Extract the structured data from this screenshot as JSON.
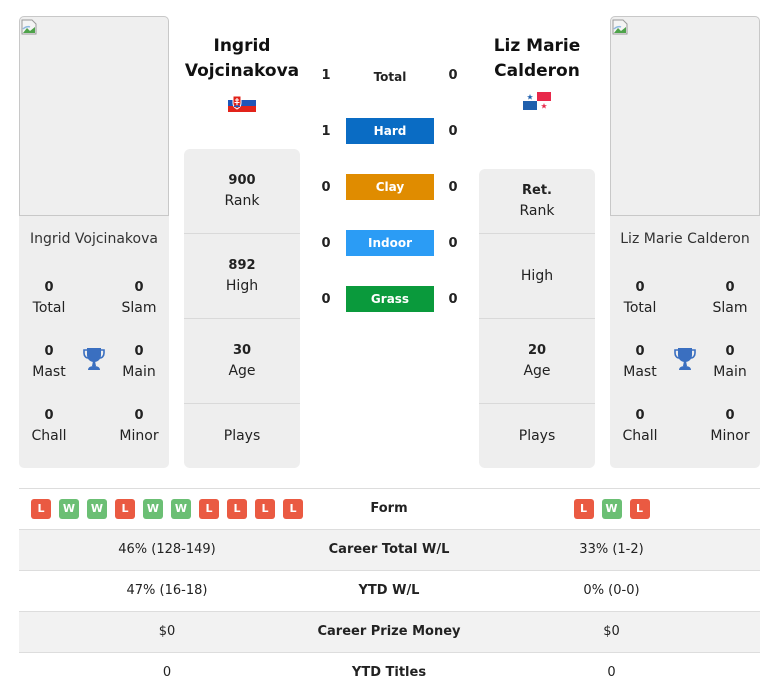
{
  "colors": {
    "hard": "#0a6cc4",
    "clay": "#e08c00",
    "indoor": "#2b9cf5",
    "grass": "#0a9a3c",
    "win": "#6bbf74",
    "loss": "#ea5a42",
    "trophy": "#3a6fc0"
  },
  "left_player": {
    "name": "Ingrid Vojcinakova",
    "name_line1": "Ingrid",
    "name_line2": "Vojcinakova",
    "flag_icon": "slovakia-flag-icon",
    "titles": {
      "total": {
        "value": "0",
        "label": "Total"
      },
      "slam": {
        "value": "0",
        "label": "Slam"
      },
      "mast": {
        "value": "0",
        "label": "Mast"
      },
      "main": {
        "value": "0",
        "label": "Main"
      },
      "chall": {
        "value": "0",
        "label": "Chall"
      },
      "minor": {
        "value": "0",
        "label": "Minor"
      }
    },
    "stats": [
      {
        "value": "900",
        "label": "Rank"
      },
      {
        "value": "892",
        "label": "High"
      },
      {
        "value": "30",
        "label": "Age"
      },
      {
        "value": "",
        "label": "Plays"
      }
    ]
  },
  "right_player": {
    "name": "Liz Marie Calderon",
    "name_line1": "Liz Marie",
    "name_line2": "Calderon",
    "flag_icon": "panama-flag-icon",
    "titles": {
      "total": {
        "value": "0",
        "label": "Total"
      },
      "slam": {
        "value": "0",
        "label": "Slam"
      },
      "mast": {
        "value": "0",
        "label": "Mast"
      },
      "main": {
        "value": "0",
        "label": "Main"
      },
      "chall": {
        "value": "0",
        "label": "Chall"
      },
      "minor": {
        "value": "0",
        "label": "Minor"
      }
    },
    "stats": [
      {
        "value": "Ret.",
        "label": "Rank"
      },
      {
        "value": "",
        "label": "High"
      },
      {
        "value": "20",
        "label": "Age"
      },
      {
        "value": "",
        "label": "Plays"
      }
    ]
  },
  "h2h": [
    {
      "label": "Total",
      "left": "1",
      "right": "0",
      "color_key": "none"
    },
    {
      "label": "Hard",
      "left": "1",
      "right": "0",
      "color_key": "hard"
    },
    {
      "label": "Clay",
      "left": "0",
      "right": "0",
      "color_key": "clay"
    },
    {
      "label": "Indoor",
      "left": "0",
      "right": "0",
      "color_key": "indoor"
    },
    {
      "label": "Grass",
      "left": "0",
      "right": "0",
      "color_key": "grass"
    }
  ],
  "comparison": {
    "form": {
      "label": "Form",
      "left": [
        "L",
        "W",
        "W",
        "L",
        "W",
        "W",
        "L",
        "L",
        "L",
        "L"
      ],
      "right": [
        "L",
        "W",
        "L"
      ]
    },
    "rows": [
      {
        "label": "Career Total W/L",
        "left": "46% (128-149)",
        "right": "33% (1-2)"
      },
      {
        "label": "YTD W/L",
        "left": "47% (16-18)",
        "right": "0% (0-0)"
      },
      {
        "label": "Career Prize Money",
        "left": "$0",
        "right": "$0"
      },
      {
        "label": "YTD Titles",
        "left": "0",
        "right": "0"
      }
    ]
  }
}
